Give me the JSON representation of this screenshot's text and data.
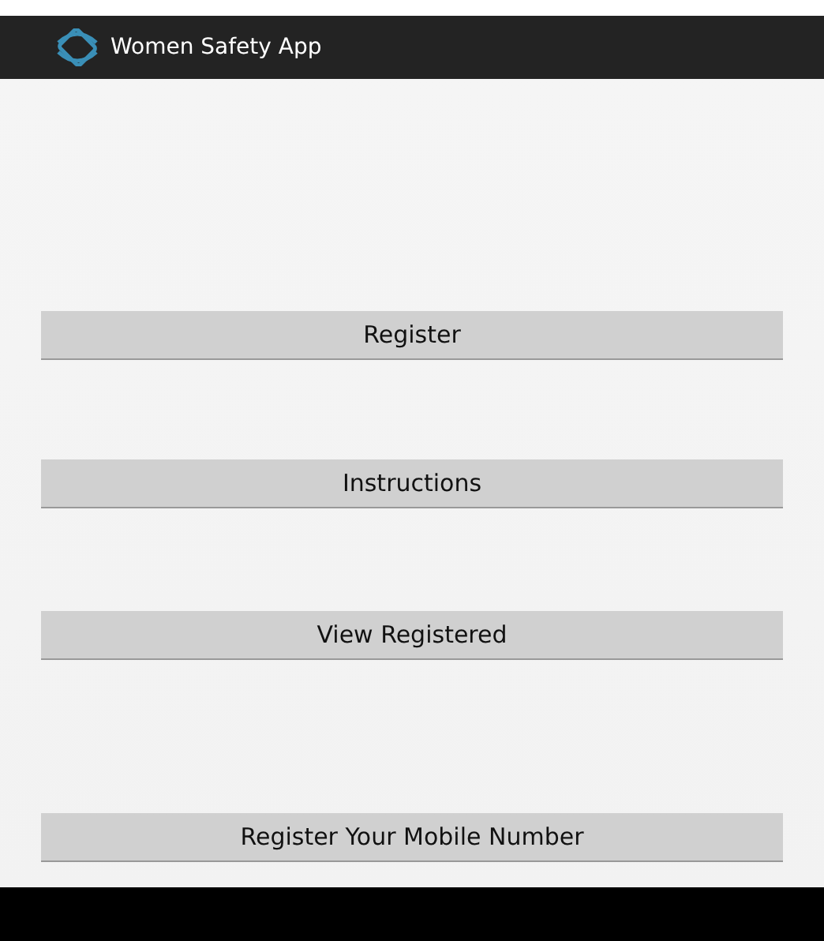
{
  "app_bar": {
    "title": "Women Safety App"
  },
  "buttons": [
    {
      "label": "Register"
    },
    {
      "label": "Instructions"
    },
    {
      "label": "View Registered"
    },
    {
      "label": "Register Your Mobile Number"
    }
  ]
}
